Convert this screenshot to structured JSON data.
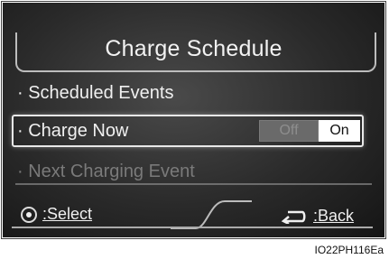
{
  "header": {
    "title": "Charge Schedule"
  },
  "menu": {
    "items": [
      {
        "label": "· Scheduled Events"
      },
      {
        "label": "· Charge Now"
      },
      {
        "label": "· Next Charging Event"
      }
    ],
    "toggle": {
      "off_label": "Off",
      "on_label": "On",
      "state": "On"
    }
  },
  "footer": {
    "select_label": ":Select",
    "back_label": ":Back"
  },
  "figure_id": "IO22PH116Ea",
  "icons": {
    "select": "dial-knob-icon",
    "back": "return-arrow-icon"
  },
  "colors": {
    "screen_background": "#2a2a2a",
    "text": "#f0f0f0",
    "disabled_text": "#7a7a7a",
    "toggle_on_bg": "#ffffff"
  }
}
